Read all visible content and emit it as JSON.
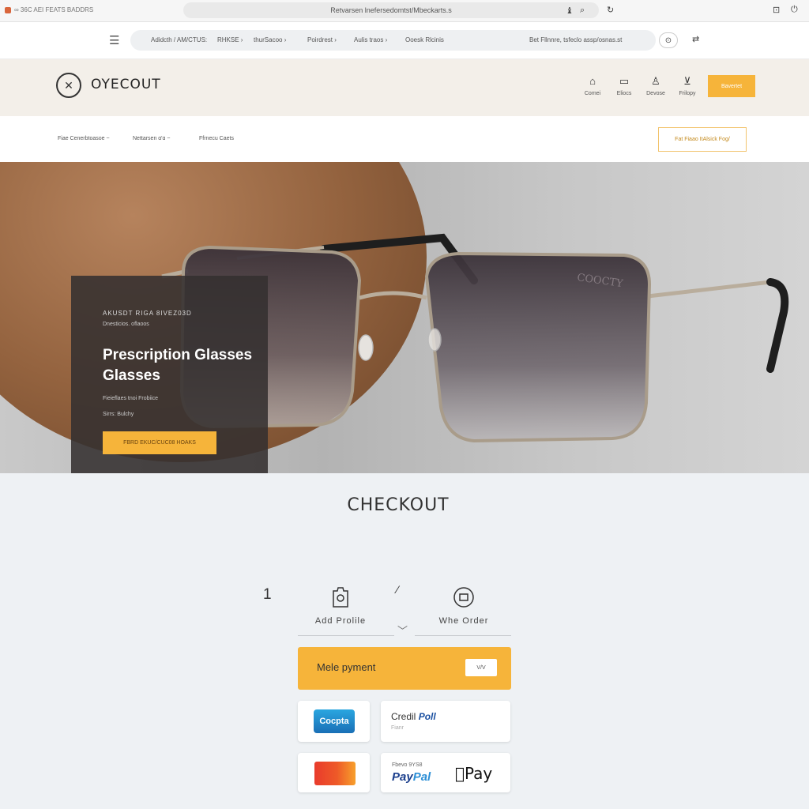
{
  "browser": {
    "tab_title": "∞ 36C AEI FEATS BADDRS",
    "address": "Retvarsen lnefersedomtst/Mbeckarts.s",
    "icons": [
      "extension-icon",
      "search-icon",
      "refresh-icon",
      "profile-icon",
      "menu-icon"
    ]
  },
  "navbar": {
    "links": [
      "Adidcth / AM/CTUS:",
      "RHKSE ›",
      "thurSacoo ›",
      "Poirdrest ›",
      "Aulis traos ›",
      "Ooesk Rlcinis"
    ],
    "search_text": "Bet Fllnnre, tsfeclo assp/osnas.st"
  },
  "header": {
    "logo_text": "OYECOUT",
    "icons": [
      {
        "label": "Comei",
        "icon": "bag-icon"
      },
      {
        "label": "Eliocs",
        "icon": "box-icon"
      },
      {
        "label": "Devose",
        "icon": "user-icon"
      },
      {
        "label": "Frilopy",
        "icon": "cart-icon"
      }
    ],
    "cta": "Bavertet"
  },
  "subnav": {
    "items": [
      "Fiae Cenerbtoasoe ~",
      "Nettarsen ɑ'ɑ ~",
      "Ffrnecu Caets"
    ],
    "button": "Fat Fiaao ItAlsick  Fog/"
  },
  "hero": {
    "kicker": "AKUSDT RIGA 8IVEZ03D",
    "subtitle": "Dnesticios. oflaoos",
    "title": "Prescription Glasses Glasses",
    "desc1": "Fieieflaes tnoi Frobiice",
    "desc2": "Sirrs: Bulchy",
    "button": "FBRD EKUC/CUC08 HOAKS",
    "lens_watermark": "COOCTY"
  },
  "checkout": {
    "title": "CHECKOUT",
    "step_number": "1",
    "steps": [
      {
        "label": "Add Prolile",
        "icon": "profile-tag-icon"
      },
      {
        "label": "Whe Order",
        "icon": "order-icon"
      }
    ],
    "payment_bar": {
      "label": "Mele pyment",
      "mini": "V/V"
    },
    "methods": {
      "copia": "Cocpta",
      "credit_title_a": "Credil ",
      "credit_title_b": "Poll",
      "credit_sub": "Fianr",
      "paypal_small": "Fbevo 9YS8",
      "paypal_a": "Pay",
      "paypal_b": "Pal",
      "apple_pay": "Pay"
    }
  },
  "colors": {
    "accent": "#f6b43a",
    "header_bg": "#f3efe9",
    "page_bg": "#eef1f4",
    "hero_card": "#343030"
  }
}
